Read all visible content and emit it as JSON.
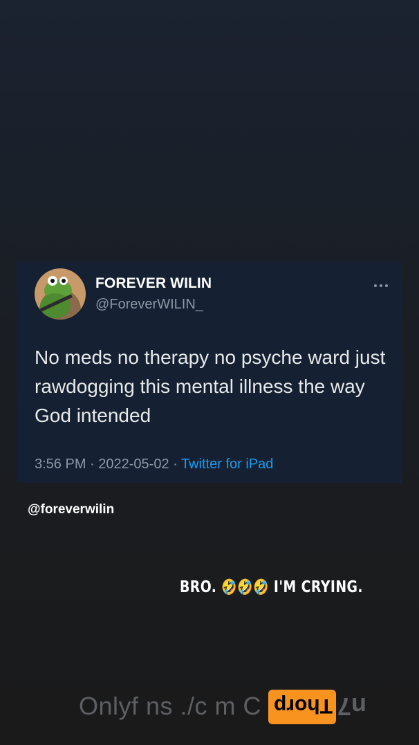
{
  "tweet": {
    "display_name": "FOREVER WILIN",
    "handle": "@ForeverWILIN_",
    "text": "No meds no therapy no psyche ward just rawdogging this mental illness the way God intended",
    "time": "3:56 PM",
    "separator": " · ",
    "date": "2022-05-02",
    "source": "Twitter for iPad",
    "avatar_icon": "frog-avatar-icon",
    "more_icon": "more-options-icon"
  },
  "credit": "@foreverwilin",
  "caption": {
    "text_before": "BRO. ",
    "emojis": "🤣🤣🤣",
    "text_after": " I'M CRYING."
  },
  "watermark": {
    "text": "Onlyf ns ./c m C",
    "logo_text": "Thorp",
    "logo_suffix": "n7",
    "badge_color": "#f7931e"
  },
  "colors": {
    "tweet_bg": "#152132",
    "link_blue": "#1d9bf0",
    "muted": "#8b98a5"
  }
}
